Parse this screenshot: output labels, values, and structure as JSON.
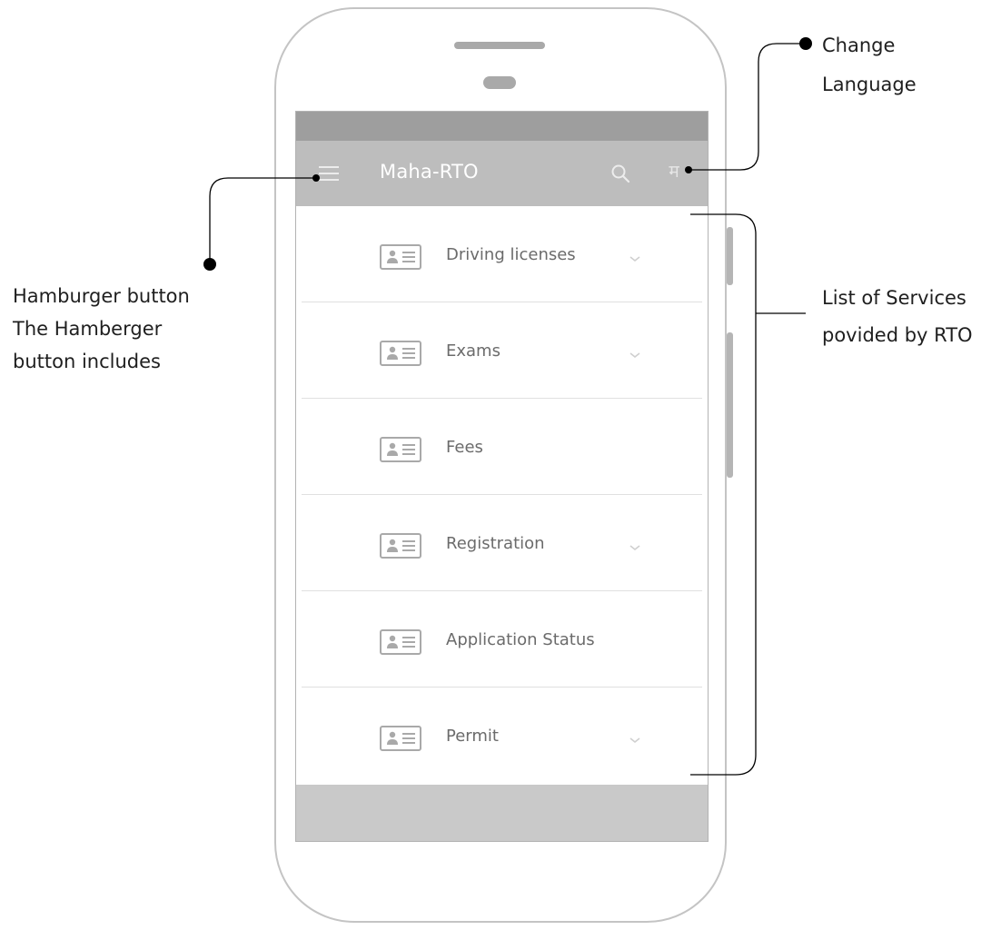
{
  "app_bar": {
    "title": "Maha-RTO",
    "language_glyph": "म"
  },
  "services": [
    {
      "label": "Driving licenses",
      "expandable": true
    },
    {
      "label": "Exams",
      "expandable": true
    },
    {
      "label": "Fees",
      "expandable": false
    },
    {
      "label": "Registration",
      "expandable": true
    },
    {
      "label": "Application Status",
      "expandable": false
    },
    {
      "label": "Permit",
      "expandable": true
    }
  ],
  "annotations": {
    "change_language": [
      "Change",
      "Language"
    ],
    "hamburger": [
      "Hamburger button",
      "The Hamberger",
      "button includes"
    ],
    "services": [
      "List of Services",
      "povided by  RTO"
    ]
  },
  "colors": {
    "app_bar": "#bdbdbd",
    "status_bar": "#9e9e9e",
    "bottom_bar": "#c9c9c9",
    "icon_gray": "#a9a9a9"
  },
  "icons": {
    "menu": "hamburger-icon",
    "search": "search-icon",
    "service": "id-card-icon",
    "expand": "chevron-down-icon"
  }
}
